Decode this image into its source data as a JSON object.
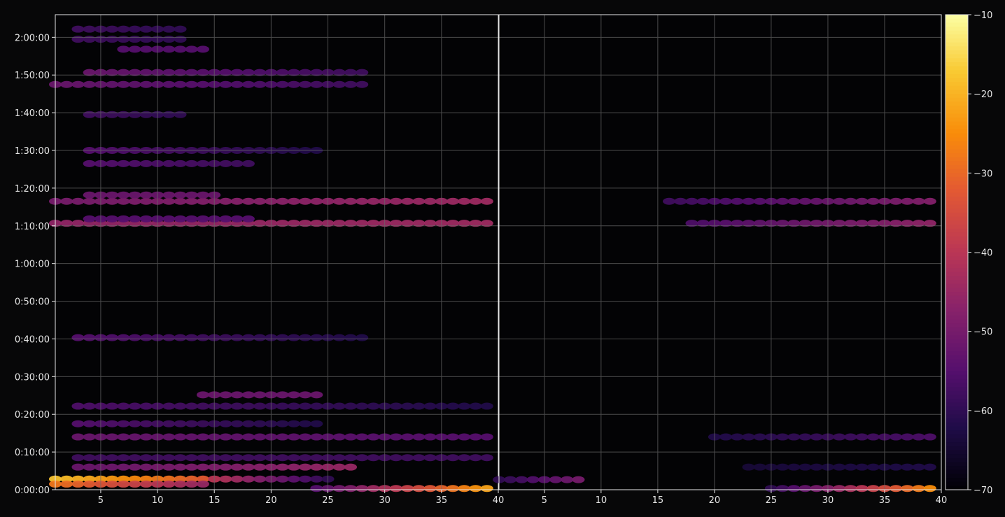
{
  "chart_data": {
    "type": "heatmap",
    "title": "",
    "xlabel": "",
    "ylabel": "",
    "colormap": "inferno",
    "colors": {
      "background": "#070708",
      "grid": "#6a6a6a",
      "text": "#e6e6e6",
      "axis": "#e6e6e6"
    },
    "panels": [
      {
        "name": "",
        "xlim": [
          1,
          40
        ],
        "x_ticks": [
          5,
          10,
          15,
          20,
          25,
          30,
          35,
          40
        ]
      },
      {
        "name": "",
        "xlim": [
          1,
          40
        ],
        "x_ticks": [
          5,
          10,
          15,
          20,
          25,
          30,
          35,
          40
        ]
      }
    ],
    "y_range_seconds": [
      0,
      7560
    ],
    "y_ticks": [
      {
        "value": 0,
        "label": "0:00:00"
      },
      {
        "value": 600,
        "label": "0:10:00"
      },
      {
        "value": 1200,
        "label": "0:20:00"
      },
      {
        "value": 1800,
        "label": "0:30:00"
      },
      {
        "value": 2400,
        "label": "0:40:00"
      },
      {
        "value": 3000,
        "label": "0:50:00"
      },
      {
        "value": 3600,
        "label": "1:00:00"
      },
      {
        "value": 4200,
        "label": "1:10:00"
      },
      {
        "value": 4800,
        "label": "1:20:00"
      },
      {
        "value": 5400,
        "label": "1:30:00"
      },
      {
        "value": 6000,
        "label": "1:40:00"
      },
      {
        "value": 6600,
        "label": "1:50:00"
      },
      {
        "value": 7200,
        "label": "2:00:00"
      }
    ],
    "colorbar": {
      "range": [
        -70,
        -10
      ],
      "ticks": [
        -10,
        -20,
        -30,
        -40,
        -50,
        -60,
        -70
      ],
      "tick_labels": [
        "−10",
        "−20",
        "−30",
        "−40",
        "−50",
        "−60",
        "−70"
      ]
    },
    "bands": [
      {
        "panel": 0,
        "t": 170,
        "x_from": 1,
        "x_to": 14,
        "v_start": -18,
        "v_end": -32
      },
      {
        "panel": 0,
        "t": 170,
        "x_from": 15,
        "x_to": 25,
        "v_start": -40,
        "v_end": -60
      },
      {
        "panel": 0,
        "t": 90,
        "x_from": 1,
        "x_to": 14,
        "v_start": -28,
        "v_end": -45
      },
      {
        "panel": 0,
        "t": 20,
        "x_from": 24,
        "x_to": 39,
        "v_start": -55,
        "v_end": -22
      },
      {
        "panel": 0,
        "t": 360,
        "x_from": 3,
        "x_to": 27,
        "v_start": -52,
        "v_end": -45
      },
      {
        "panel": 0,
        "t": 510,
        "x_from": 3,
        "x_to": 39,
        "v_start": -58,
        "v_end": -58
      },
      {
        "panel": 0,
        "t": 840,
        "x_from": 3,
        "x_to": 39,
        "v_start": -52,
        "v_end": -55
      },
      {
        "panel": 0,
        "t": 1050,
        "x_from": 3,
        "x_to": 24,
        "v_start": -55,
        "v_end": -62
      },
      {
        "panel": 0,
        "t": 1330,
        "x_from": 3,
        "x_to": 39,
        "v_start": -56,
        "v_end": -62
      },
      {
        "panel": 0,
        "t": 1510,
        "x_from": 14,
        "x_to": 24,
        "v_start": -52,
        "v_end": -52
      },
      {
        "panel": 0,
        "t": 2420,
        "x_from": 3,
        "x_to": 28,
        "v_start": -55,
        "v_end": -62
      },
      {
        "panel": 0,
        "t": 4240,
        "x_from": 1,
        "x_to": 39,
        "v_start": -46,
        "v_end": -44
      },
      {
        "panel": 0,
        "t": 4590,
        "x_from": 1,
        "x_to": 39,
        "v_start": -50,
        "v_end": -44
      },
      {
        "panel": 0,
        "t": 4310,
        "x_from": 4,
        "x_to": 18,
        "v_start": -55,
        "v_end": -55
      },
      {
        "panel": 0,
        "t": 4690,
        "x_from": 4,
        "x_to": 15,
        "v_start": -52,
        "v_end": -52
      },
      {
        "panel": 0,
        "t": 5190,
        "x_from": 4,
        "x_to": 18,
        "v_start": -55,
        "v_end": -58
      },
      {
        "panel": 0,
        "t": 5400,
        "x_from": 4,
        "x_to": 24,
        "v_start": -55,
        "v_end": -62
      },
      {
        "panel": 0,
        "t": 5970,
        "x_from": 4,
        "x_to": 12,
        "v_start": -58,
        "v_end": -60
      },
      {
        "panel": 0,
        "t": 6450,
        "x_from": 1,
        "x_to": 28,
        "v_start": -52,
        "v_end": -58
      },
      {
        "panel": 0,
        "t": 6640,
        "x_from": 4,
        "x_to": 28,
        "v_start": -52,
        "v_end": -58
      },
      {
        "panel": 0,
        "t": 7010,
        "x_from": 7,
        "x_to": 14,
        "v_start": -55,
        "v_end": -55
      },
      {
        "panel": 0,
        "t": 7170,
        "x_from": 3,
        "x_to": 12,
        "v_start": -58,
        "v_end": -60
      },
      {
        "panel": 0,
        "t": 7330,
        "x_from": 3,
        "x_to": 12,
        "v_start": -58,
        "v_end": -60
      },
      {
        "panel": 1,
        "t": 160,
        "x_from": 1,
        "x_to": 8,
        "v_start": -60,
        "v_end": -50
      },
      {
        "panel": 1,
        "t": 20,
        "x_from": 25,
        "x_to": 39,
        "v_start": -60,
        "v_end": -25
      },
      {
        "panel": 1,
        "t": 840,
        "x_from": 20,
        "x_to": 39,
        "v_start": -62,
        "v_end": -56
      },
      {
        "panel": 1,
        "t": 4240,
        "x_from": 18,
        "x_to": 39,
        "v_start": -56,
        "v_end": -46
      },
      {
        "panel": 1,
        "t": 4590,
        "x_from": 16,
        "x_to": 39,
        "v_start": -58,
        "v_end": -48
      },
      {
        "panel": 1,
        "t": 360,
        "x_from": 23,
        "x_to": 39,
        "v_start": -64,
        "v_end": -62
      }
    ]
  }
}
